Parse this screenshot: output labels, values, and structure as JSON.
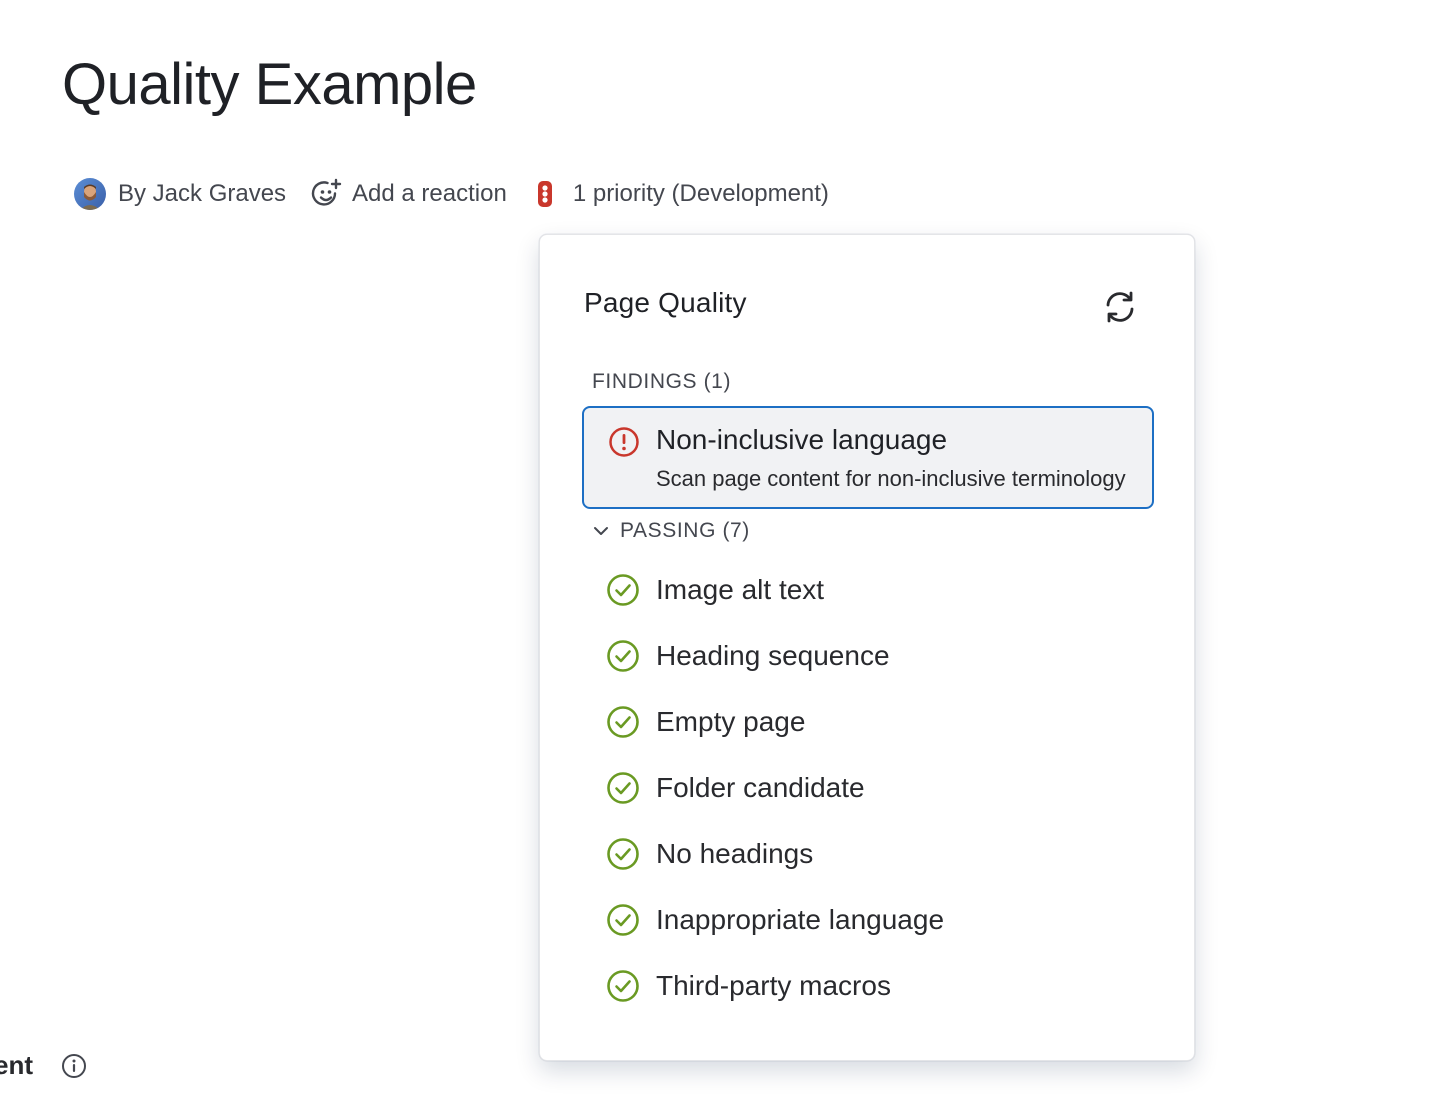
{
  "page": {
    "title": "Quality Example"
  },
  "byline": {
    "author": "By Jack Graves",
    "reaction": "Add a reaction",
    "priority": "1 priority (Development)",
    "priority_color": "#c9372c"
  },
  "quality_panel": {
    "title": "Page Quality",
    "refresh_icon": "refresh-icon",
    "findings_header": "FINDINGS (1)",
    "findings": [
      {
        "title": "Non-inclusive language",
        "description": "Scan page content for non-inclusive terminology",
        "status": "error",
        "icon": "error-circle-icon",
        "color": "#c9372c"
      }
    ],
    "passing_header": "PASSING (7)",
    "passing_color": "#6a9a23",
    "passing": [
      {
        "label": "Image alt text",
        "icon": "check-circle-icon"
      },
      {
        "label": "Heading sequence",
        "icon": "check-circle-icon"
      },
      {
        "label": "Empty page",
        "icon": "check-circle-icon"
      },
      {
        "label": "Folder candidate",
        "icon": "check-circle-icon"
      },
      {
        "label": "No headings",
        "icon": "check-circle-icon"
      },
      {
        "label": "Inappropriate language",
        "icon": "check-circle-icon"
      },
      {
        "label": "Third-party macros",
        "icon": "check-circle-icon"
      }
    ]
  },
  "bottom": {
    "partial_label": "ent",
    "info_icon": "info-icon"
  },
  "colors": {
    "selected_border": "#1d6fc4",
    "selected_bg": "#f1f2f4"
  }
}
